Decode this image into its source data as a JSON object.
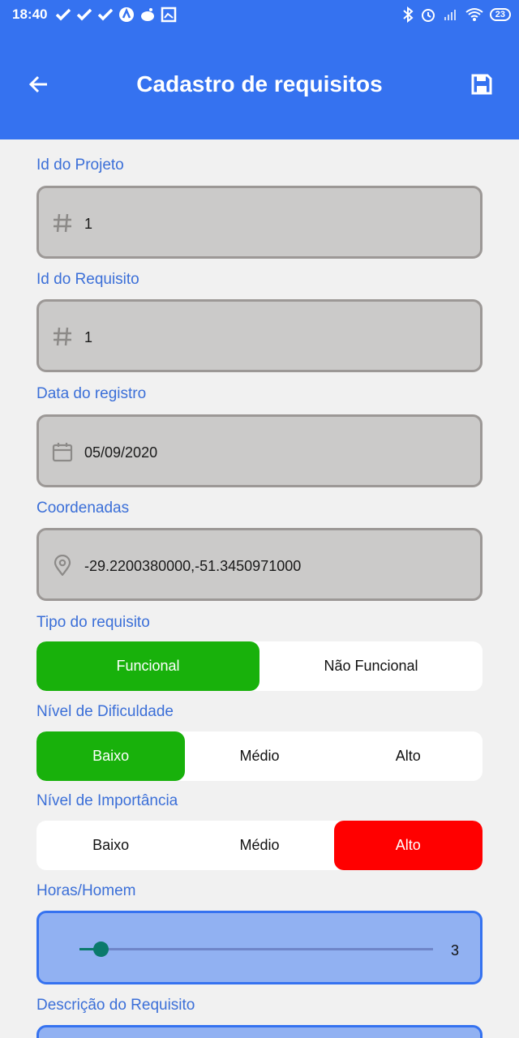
{
  "status_bar": {
    "time": "18:40",
    "battery": "23"
  },
  "app_bar": {
    "title": "Cadastro de requisitos"
  },
  "fields": {
    "id_projeto": {
      "label": "Id do Projeto",
      "value": "1",
      "icon": "hash-icon"
    },
    "id_requisito": {
      "label": "Id do Requisito",
      "value": "1",
      "icon": "hash-icon"
    },
    "data_registro": {
      "label": "Data do registro",
      "value": "05/09/2020",
      "icon": "calendar-icon"
    },
    "coordenadas": {
      "label": "Coordenadas",
      "value": "-29.2200380000,-51.3450971000",
      "icon": "location-pin-icon"
    }
  },
  "tipo_requisito": {
    "label": "Tipo do requisito",
    "options": [
      "Funcional",
      "Não Funcional"
    ],
    "selected": "Funcional"
  },
  "nivel_dificuldade": {
    "label": "Nível de Dificuldade",
    "options": [
      "Baixo",
      "Médio",
      "Alto"
    ],
    "selected": "Baixo"
  },
  "nivel_importancia": {
    "label": "Nível de Importância",
    "options": [
      "Baixo",
      "Médio",
      "Alto"
    ],
    "selected": "Alto"
  },
  "horas_homem": {
    "label": "Horas/Homem",
    "value": "3",
    "fraction": 0.06
  },
  "descricao": {
    "label": "Descrição do Requisito"
  },
  "colors": {
    "primary": "#3572f0",
    "selected_green": "#18b10b",
    "selected_red": "#ff0000",
    "label_blue": "#3b6fd8"
  }
}
